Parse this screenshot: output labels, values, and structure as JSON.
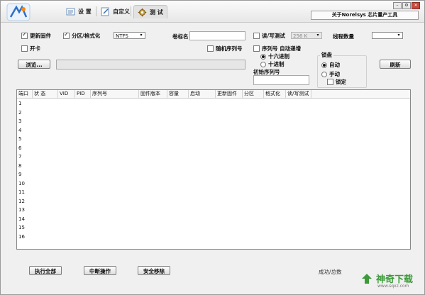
{
  "header": {
    "tabs": [
      {
        "label": "设 置",
        "icon": "settings-icon"
      },
      {
        "label": "自定义",
        "icon": "customize-icon"
      },
      {
        "label": "测 试",
        "icon": "gear-icon",
        "active": true
      }
    ],
    "app_title": "关于Norelsys 芯片量产工具"
  },
  "options": {
    "update_firmware": {
      "label": "更新固件",
      "checked": true
    },
    "partition_format": {
      "label": "分区/格式化",
      "checked": true
    },
    "filesystem": {
      "value": "NTFS"
    },
    "volume_label": {
      "label": "卷标名",
      "value": ""
    },
    "rw_test": {
      "label": "读/写测试",
      "checked": false
    },
    "rw_size": {
      "value": "256 K"
    },
    "thread_count": {
      "label": "线程数量",
      "value": ""
    },
    "card_open": {
      "label": "开卡",
      "checked": false
    },
    "random_serial": {
      "label": "随机序列号",
      "checked": false
    },
    "serial_auto_inc": {
      "label": "序列号 自动递增",
      "checked": false
    },
    "hex": {
      "label": "十六进制",
      "selected": true
    },
    "dec": {
      "label": "十进制",
      "selected": false
    },
    "initial_serial": {
      "label": "初始序列号",
      "value": ""
    },
    "lock_group": {
      "title": "锁盘",
      "auto": {
        "label": "自动",
        "selected": true
      },
      "manual": {
        "label": "手动",
        "selected": false
      },
      "locked": {
        "label": "锁定",
        "checked": false
      }
    }
  },
  "buttons": {
    "browse": "浏览...",
    "refresh": "刷新",
    "run_all": "执行全部",
    "interrupt": "中断操作",
    "safe_remove": "安全移除"
  },
  "path": {
    "value": ""
  },
  "table": {
    "columns": [
      "端口",
      "状 态",
      "VID",
      "PID",
      "序列号",
      "固件版本",
      "容量",
      "启动",
      "更新固件",
      "分区",
      "格式化",
      "读/写测试"
    ],
    "rows": [
      "1",
      "2",
      "3",
      "4",
      "5",
      "6",
      "7",
      "8",
      "9",
      "10",
      "11",
      "12",
      "13",
      "14",
      "15",
      "16"
    ]
  },
  "status": {
    "success_total": "成功/总数"
  },
  "watermark": {
    "text": "神奇下载",
    "url": "www.sqxz.com"
  }
}
